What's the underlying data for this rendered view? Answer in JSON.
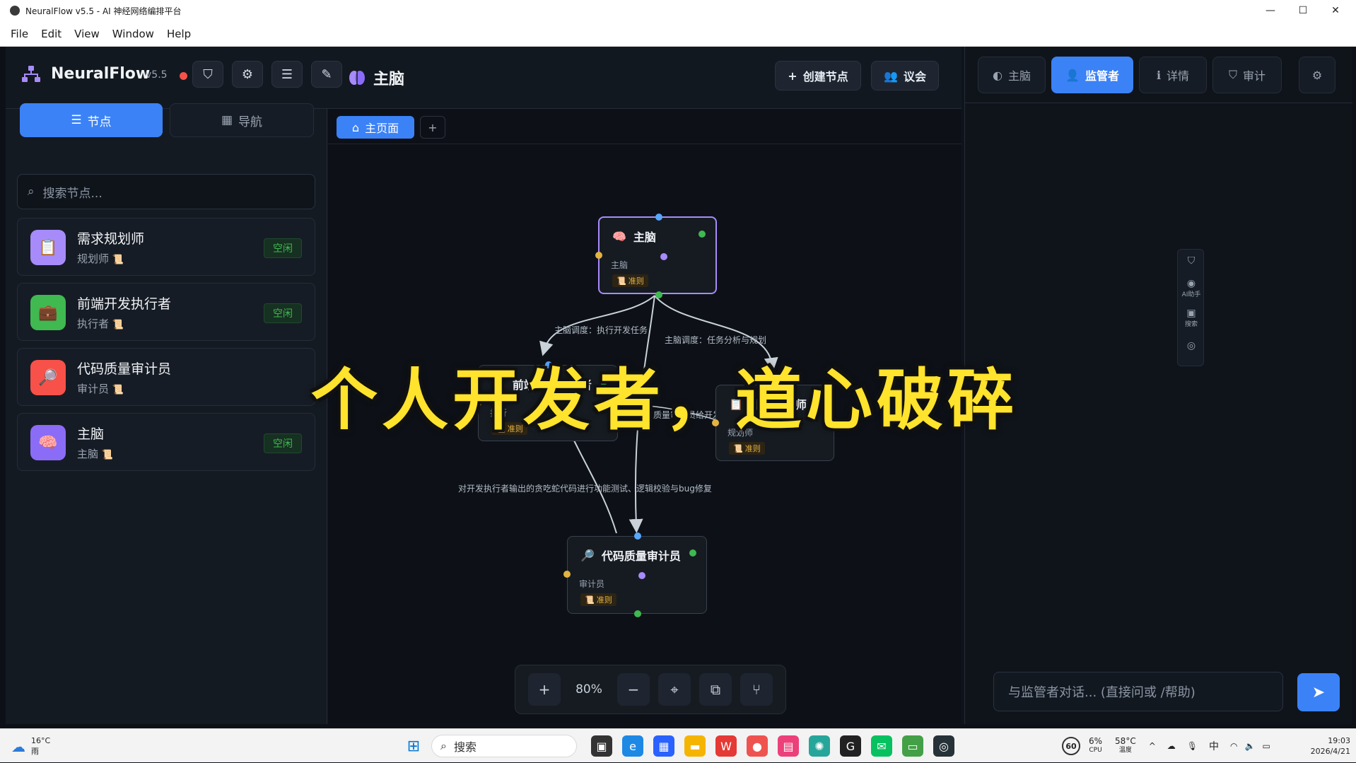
{
  "window": {
    "title": "NeuralFlow v5.5 - AI 神经网络编排平台",
    "minimize": "—",
    "maximize": "☐",
    "close": "✕"
  },
  "menu": [
    "File",
    "Edit",
    "View",
    "Window",
    "Help"
  ],
  "header": {
    "brand": "NeuralFlow",
    "version": "v5.5",
    "current_node": "主脑",
    "create_node_label": "创建节点",
    "council_label": "议会"
  },
  "left_tabs": {
    "nodes": "节点",
    "navigation": "导航"
  },
  "search": {
    "placeholder": "搜索节点..."
  },
  "node_list": [
    {
      "name": "需求规划师",
      "role": "规划师",
      "status": "空闲",
      "color": "#a78bfa"
    },
    {
      "name": "前端开发执行者",
      "role": "执行者",
      "status": "空闲",
      "color": "#3fb950"
    },
    {
      "name": "代码质量审计员",
      "role": "审计员",
      "status": "",
      "color": "#f85149"
    },
    {
      "name": "主脑",
      "role": "主脑",
      "status": "空闲",
      "color": "#8b6cf6"
    }
  ],
  "canvas": {
    "tab_label": "主页面",
    "add_tab": "+",
    "zoom": "80%",
    "nodes": {
      "brain": {
        "title": "主脑",
        "role": "主脑",
        "badge": "准则"
      },
      "frontend": {
        "title": "前端开发执行者",
        "role": "执行",
        "badge": "准则"
      },
      "planner": {
        "title": "需求规划师",
        "role": "规划师",
        "badge": "准则"
      },
      "auditor": {
        "title": "代码质量审计员",
        "role": "审计员",
        "badge": "准则"
      }
    },
    "edges": {
      "brain_to_frontend": "主脑调度：执行开发任务",
      "brain_to_planner": "主脑调度：任务分析与规划",
      "planner_to_frontend": "质量审计员给开发",
      "frontend_to_auditor": "对开发执行者输出的贪吃蛇代码进行功能测试、逻辑校验与bug修复"
    }
  },
  "right_tabs": {
    "brain": "主脑",
    "supervisor": "监管者",
    "details": "详情",
    "audit": "审计"
  },
  "tool_strip": {
    "ai_helper": "AI助手",
    "search": "搜索"
  },
  "chat": {
    "placeholder": "与监管者对话... (直接问或 /帮助)"
  },
  "overlay_caption": "个人开发者，道心破碎",
  "taskbar": {
    "weather_temp": "16°C",
    "weather_desc": "雨",
    "search": "搜索",
    "fps": "60",
    "cpu_value": "6%",
    "cpu_label": "CPU",
    "temp_value": "58°C",
    "temp_label": "温度",
    "ime": "中",
    "time": "19:03",
    "date": "2026/4/21"
  },
  "colors": {
    "accent": "#3b82f6",
    "brain_purple": "#a78bfa",
    "idle_green": "#3fb950",
    "caption_yellow": "#ffe32c"
  }
}
